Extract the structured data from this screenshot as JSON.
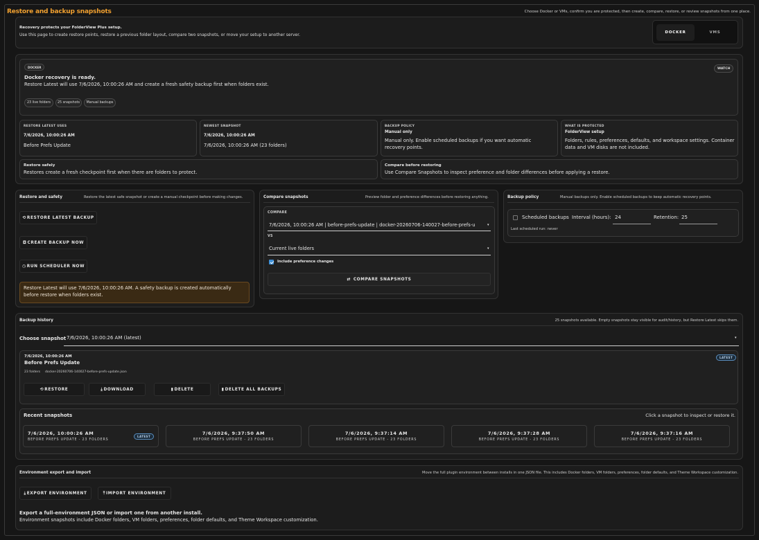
{
  "header": {
    "title": "Restore and backup snapshots",
    "subtitle": "Choose Docker or VMs, confirm you are protected, then create, compare, restore, or review snapshots from one place."
  },
  "intro": {
    "title": "Recovery protects your FolderView Plus setup.",
    "text": "Use this page to create restore points, restore a previous folder layout, compare two snapshots, or move your setup to another server."
  },
  "toggle": {
    "docker": "DOCKER",
    "vms": "VMS"
  },
  "status": {
    "badge": "DOCKER",
    "watch": "WATCH",
    "title": "Docker recovery is ready.",
    "text": "Restore Latest will use 7/6/2026, 10:00:26 AM and create a fresh safety backup first when folders exist.",
    "pills": [
      "23 live folders",
      "25 snapshots",
      "Manual backups"
    ]
  },
  "info": [
    {
      "label": "RESTORE LATEST USES",
      "value": "7/6/2026, 10:00:26 AM",
      "text": "Before Prefs Update"
    },
    {
      "label": "NEWEST SNAPSHOT",
      "value": "7/6/2026, 10:00:26 AM",
      "text": "7/6/2026, 10:00:26 AM (23 folders)"
    },
    {
      "label": "BACKUP POLICY",
      "value": "Manual only",
      "text": "Manual only. Enable scheduled backups if you want automatic recovery points."
    },
    {
      "label": "WHAT IS PROTECTED",
      "value": "FolderView setup",
      "text": "Folders, rules, preferences, defaults, and workspace settings. Container data and VM disks are not included."
    }
  ],
  "tips": [
    {
      "title": "Restore safely",
      "text": "Restores create a fresh checkpoint first when there are folders to protect."
    },
    {
      "title": "Compare before restoring",
      "text": "Use Compare Snapshots to inspect preference and folder differences before applying a restore."
    }
  ],
  "safety": {
    "title": "Restore and safety",
    "subtitle": "Restore the latest safe snapshot or create a manual checkpoint before making changes.",
    "restore_latest": "RESTORE LATEST BACKUP",
    "create_backup": "CREATE BACKUP NOW",
    "run_scheduler": "RUN SCHEDULER NOW",
    "warning": "Restore Latest will use 7/6/2026, 10:00:26 AM. A safety backup is created automatically before restore when folders exist."
  },
  "compare": {
    "title": "Compare snapshots",
    "subtitle": "Preview folder and preference differences before restoring anything.",
    "label": "COMPARE",
    "left": "7/6/2026, 10:00:26 AM | before-prefs-update | docker-20260706-140027-before-prefs-u",
    "vs": "VS",
    "right": "Current live folders",
    "include_prefs": "Include preference changes",
    "button": "COMPARE SNAPSHOTS"
  },
  "policy": {
    "title": "Backup policy",
    "subtitle": "Manual backups only. Enable scheduled backups to keep automatic recovery points.",
    "scheduled": "Scheduled backups",
    "interval_label": "Interval (hours):",
    "interval": "24",
    "retention_label": "Retention:",
    "retention": "25",
    "last_run": "Last scheduled run: never"
  },
  "history": {
    "title": "Backup history",
    "subtitle": "25 snapshots available. Empty snapshots stay visible for audit/history, but Restore Latest skips them.",
    "choose_label": "Choose snapshot",
    "selected": "7/6/2026, 10:00:26 AM (latest)",
    "detail": {
      "date": "7/6/2026, 10:00:26 AM",
      "name": "Before Prefs Update",
      "folders": "23 folders",
      "file": "docker-20260706-140027-before-prefs-update.json",
      "badge": "LATEST",
      "restore": "RESTORE",
      "download": "DOWNLOAD",
      "delete": "DELETE",
      "delete_all": "DELETE ALL BACKUPS"
    },
    "recent_title": "Recent snapshots",
    "recent_hint": "Click a snapshot to inspect or restore it.",
    "recent": [
      {
        "date": "7/6/2026, 10:00:26 AM",
        "sub": "BEFORE PREFS UPDATE - 23 FOLDERS",
        "badge": "LATEST"
      },
      {
        "date": "7/6/2026, 9:37:50 AM",
        "sub": "BEFORE PREFS UPDATE - 23 FOLDERS"
      },
      {
        "date": "7/6/2026, 9:37:14 AM",
        "sub": "BEFORE PREFS UPDATE - 23 FOLDERS"
      },
      {
        "date": "7/6/2026, 9:37:28 AM",
        "sub": "BEFORE PREFS UPDATE - 23 FOLDERS"
      },
      {
        "date": "7/6/2026, 9:37:16 AM",
        "sub": "BEFORE PREFS UPDATE - 23 FOLDERS"
      }
    ]
  },
  "env": {
    "title": "Environment export and import",
    "subtitle": "Move the full plugin environment between installs in one JSON file. This includes Docker folders, VM folders, preferences, folder defaults, and Theme Workspace customization.",
    "export": "EXPORT ENVIRONMENT",
    "import": "IMPORT ENVIRONMENT",
    "heading": "Export a full-environment JSON or import one from another install.",
    "text": "Environment snapshots include Docker folders, VM folders, preferences, folder defaults, and Theme Workspace customization."
  },
  "colors": {
    "accent": "#f0a030",
    "warning_bg": "#3a2a14",
    "latest": "#5a8fc0"
  }
}
